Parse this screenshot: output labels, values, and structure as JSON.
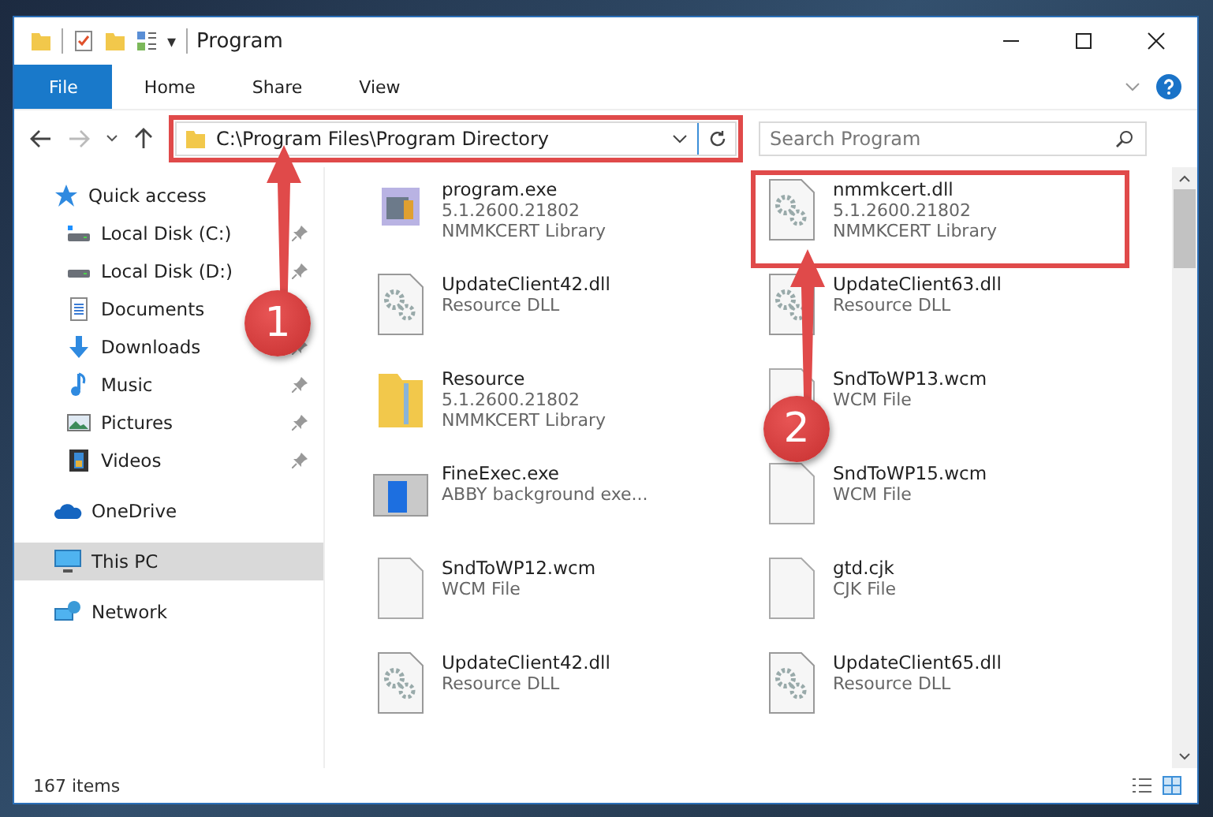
{
  "window": {
    "title": "Program"
  },
  "quick_toolbar": {
    "dropdown": "▾"
  },
  "ribbon": {
    "tabs": [
      {
        "label": "File",
        "selected": true
      },
      {
        "label": "Home",
        "selected": false
      },
      {
        "label": "Share",
        "selected": false
      },
      {
        "label": "View",
        "selected": false
      }
    ]
  },
  "address_bar": {
    "path": "C:\\Program Files\\Program Directory",
    "highlighted": true
  },
  "search": {
    "placeholder": "Search Program"
  },
  "sidebar": {
    "items": [
      {
        "label": "Quick access",
        "kind": "star",
        "pinned": false,
        "selected": false,
        "children": [
          {
            "label": "Local Disk (C:)",
            "kind": "system-drive",
            "pinned": true,
            "selected": false
          },
          {
            "label": "Local Disk (D:)",
            "kind": "drive",
            "pinned": true,
            "selected": false
          },
          {
            "label": "Documents",
            "kind": "documents",
            "pinned": true,
            "selected": false
          },
          {
            "label": "Downloads",
            "kind": "downloads",
            "pinned": true,
            "selected": false
          },
          {
            "label": "Music",
            "kind": "music",
            "pinned": true,
            "selected": false
          },
          {
            "label": "Pictures",
            "kind": "pictures",
            "pinned": true,
            "selected": false
          },
          {
            "label": "Videos",
            "kind": "videos",
            "pinned": true,
            "selected": false
          }
        ]
      },
      {
        "label": "OneDrive",
        "kind": "cloud",
        "pinned": false,
        "selected": false
      },
      {
        "label": "This PC",
        "kind": "computer",
        "pinned": false,
        "selected": true
      },
      {
        "label": "Network",
        "kind": "network",
        "pinned": false,
        "selected": false
      }
    ]
  },
  "files": [
    {
      "name": "program.exe",
      "details": [
        "5.1.2600.21802",
        "NMMKCERT Library"
      ],
      "kind": "app",
      "highlighted": false
    },
    {
      "name": "nmmkcert.dll",
      "details": [
        "5.1.2600.21802",
        "NMMKCERT Library"
      ],
      "kind": "dll",
      "highlighted": true
    },
    {
      "name": "UpdateClient42.dll",
      "details": [
        "Resource DLL"
      ],
      "kind": "dll",
      "highlighted": false
    },
    {
      "name": "UpdateClient63.dll",
      "details": [
        "Resource DLL"
      ],
      "kind": "dll",
      "highlighted": false
    },
    {
      "name": "Resource",
      "details": [
        "5.1.2600.21802",
        "NMMKCERT Library"
      ],
      "kind": "folder",
      "highlighted": false
    },
    {
      "name": "SndToWP13.wcm",
      "details": [
        "WCM File"
      ],
      "kind": "blank",
      "highlighted": false
    },
    {
      "name": "FineExec.exe",
      "details": [
        "ABBY background exe..."
      ],
      "kind": "window",
      "highlighted": false
    },
    {
      "name": "SndToWP15.wcm",
      "details": [
        "WCM File"
      ],
      "kind": "blank",
      "highlighted": false
    },
    {
      "name": "SndToWP12.wcm",
      "details": [
        "WCM File"
      ],
      "kind": "blank",
      "highlighted": false
    },
    {
      "name": "gtd.cjk",
      "details": [
        "CJK File"
      ],
      "kind": "blank",
      "highlighted": false
    },
    {
      "name": "UpdateClient42.dll",
      "details": [
        "Resource DLL"
      ],
      "kind": "dll",
      "highlighted": false
    },
    {
      "name": "UpdateClient65.dll",
      "details": [
        "Resource DLL"
      ],
      "kind": "dll",
      "highlighted": false
    }
  ],
  "status_bar": {
    "count": "167 items"
  },
  "callouts": [
    {
      "label": "1"
    },
    {
      "label": "2"
    }
  ]
}
